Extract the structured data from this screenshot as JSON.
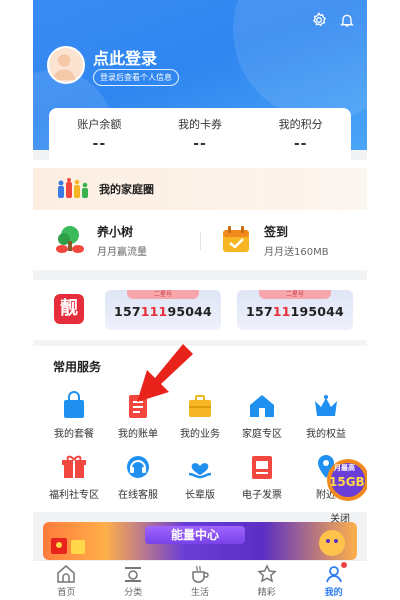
{
  "header": {
    "login_title": "点此登录",
    "login_sub": "登录后查看个人信息"
  },
  "account": [
    {
      "label": "账户余额",
      "value": "--"
    },
    {
      "label": "我的卡券",
      "value": "--"
    },
    {
      "label": "我的积分",
      "value": "--"
    }
  ],
  "family": {
    "label": "我的家庭圈"
  },
  "tasks": [
    {
      "title": "养小树",
      "sub": "月月赢流量"
    },
    {
      "title": "签到",
      "sub": "月月送160MB"
    }
  ],
  "numbers": {
    "badge": "靓",
    "cards": [
      {
        "tag": "二星号",
        "prefix": "157",
        "highlight": "111",
        "suffix": "95044"
      },
      {
        "tag": "二星号",
        "prefix": "157",
        "highlight": "11",
        "suffix": "195044"
      }
    ]
  },
  "services": {
    "title": "常用服务",
    "items": [
      {
        "label": "我的套餐",
        "icon": "bag-icon"
      },
      {
        "label": "我的账单",
        "icon": "bill-icon"
      },
      {
        "label": "我的业务",
        "icon": "briefcase-icon"
      },
      {
        "label": "家庭专区",
        "icon": "home-icon"
      },
      {
        "label": "我的权益",
        "icon": "crown-icon"
      },
      {
        "label": "福利社专区",
        "icon": "gift-icon"
      },
      {
        "label": "在线客服",
        "icon": "headset-icon"
      },
      {
        "label": "长辈版",
        "icon": "heart-hands-icon"
      },
      {
        "label": "电子发票",
        "icon": "invoice-icon"
      },
      {
        "label": "附近",
        "icon": "location-icon"
      }
    ]
  },
  "promo": {
    "top": "月最高",
    "amount": "15GB",
    "close": "关闭"
  },
  "energy": {
    "title": "能量中心"
  },
  "tabbar": [
    {
      "label": "首页",
      "icon": "home-tab-icon",
      "active": false
    },
    {
      "label": "分类",
      "icon": "category-tab-icon",
      "active": false
    },
    {
      "label": "生活",
      "icon": "coffee-tab-icon",
      "active": false
    },
    {
      "label": "精彩",
      "icon": "star-tab-icon",
      "active": false
    },
    {
      "label": "我的",
      "icon": "person-tab-icon",
      "active": true
    }
  ],
  "colors": {
    "brand": "#2f86f0",
    "accent_red": "#e8303c",
    "icon_blue": "#1f8ff0",
    "icon_yellow": "#f6b623",
    "icon_red": "#f2473f"
  }
}
